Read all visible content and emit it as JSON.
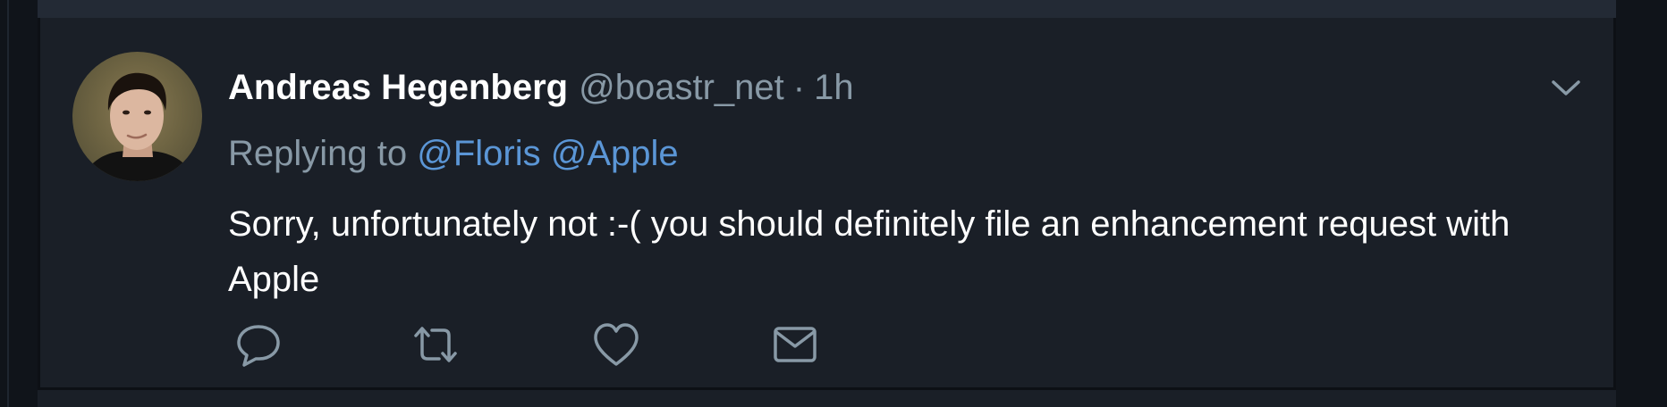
{
  "tweet": {
    "display_name": "Andreas Hegenberg",
    "handle": "@boastr_net",
    "separator": "·",
    "time": "1h",
    "replying_label": "Replying to",
    "mentions": [
      "@Floris",
      "@Apple"
    ],
    "body": "Sorry, unfortunately not :-( you should definitely file an enhancement request with Apple"
  },
  "icons": {
    "menu": "chevron-down-icon",
    "reply": "reply-icon",
    "retweet": "retweet-icon",
    "like": "heart-icon",
    "message": "envelope-icon"
  },
  "colors": {
    "background": "#1a1f27",
    "text": "#ffffff",
    "muted": "#8899a6",
    "link": "#5b96d6"
  }
}
